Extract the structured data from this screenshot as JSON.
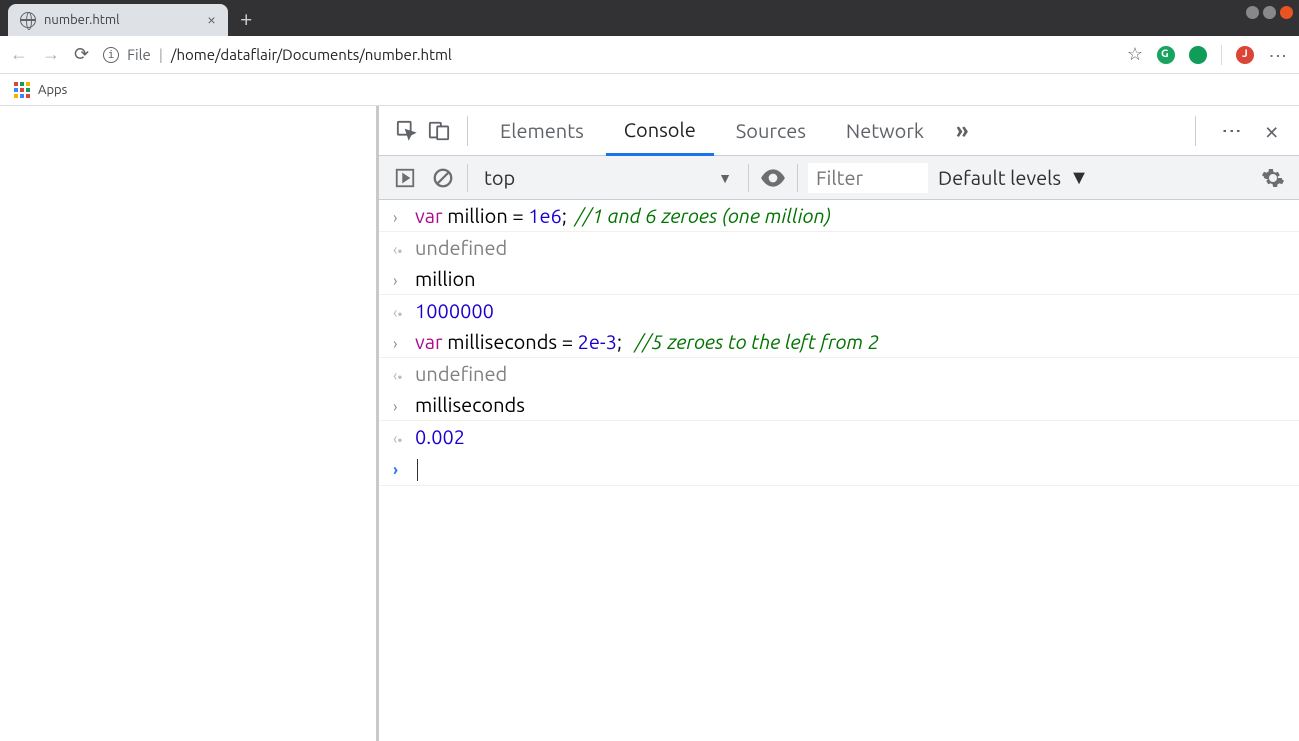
{
  "window": {
    "tab_title": "number.html",
    "new_tab_tooltip": "+"
  },
  "toolbar": {
    "file_prefix": "File",
    "url_path": "/home/dataflair/Documents/number.html"
  },
  "bookmarks": {
    "apps_label": "Apps"
  },
  "devtools": {
    "tabs": {
      "elements": "Elements",
      "console": "Console",
      "sources": "Sources",
      "network": "Network",
      "more": "»"
    },
    "filter": {
      "context": "top",
      "filter_placeholder": "Filter",
      "levels_label": "Default levels"
    },
    "console_rows": [
      {
        "kind": "input",
        "tokens": [
          {
            "t": "var",
            "c": "kw"
          },
          {
            "t": " million = "
          },
          {
            "t": "1e6",
            "c": "num"
          },
          {
            "t": ";  "
          },
          {
            "t": "//1 and 6 zeroes (one million)",
            "c": "comment"
          }
        ]
      },
      {
        "kind": "output",
        "tokens": [
          {
            "t": "undefined",
            "c": "undef"
          }
        ],
        "noborder": true
      },
      {
        "kind": "input",
        "tokens": [
          {
            "t": "million"
          }
        ]
      },
      {
        "kind": "output",
        "tokens": [
          {
            "t": "1000000",
            "c": "num"
          }
        ],
        "noborder": true
      },
      {
        "kind": "input",
        "tokens": [
          {
            "t": "var",
            "c": "kw"
          },
          {
            "t": " milliseconds = "
          },
          {
            "t": "2e-3",
            "c": "num"
          },
          {
            "t": ";   "
          },
          {
            "t": "//5 zeroes to the left from 2",
            "c": "comment"
          }
        ]
      },
      {
        "kind": "output",
        "tokens": [
          {
            "t": "undefined",
            "c": "undef"
          }
        ],
        "noborder": true
      },
      {
        "kind": "input",
        "tokens": [
          {
            "t": "milliseconds"
          }
        ]
      },
      {
        "kind": "output",
        "tokens": [
          {
            "t": "0.002",
            "c": "num"
          }
        ],
        "noborder": true
      },
      {
        "kind": "prompt",
        "tokens": []
      }
    ]
  }
}
